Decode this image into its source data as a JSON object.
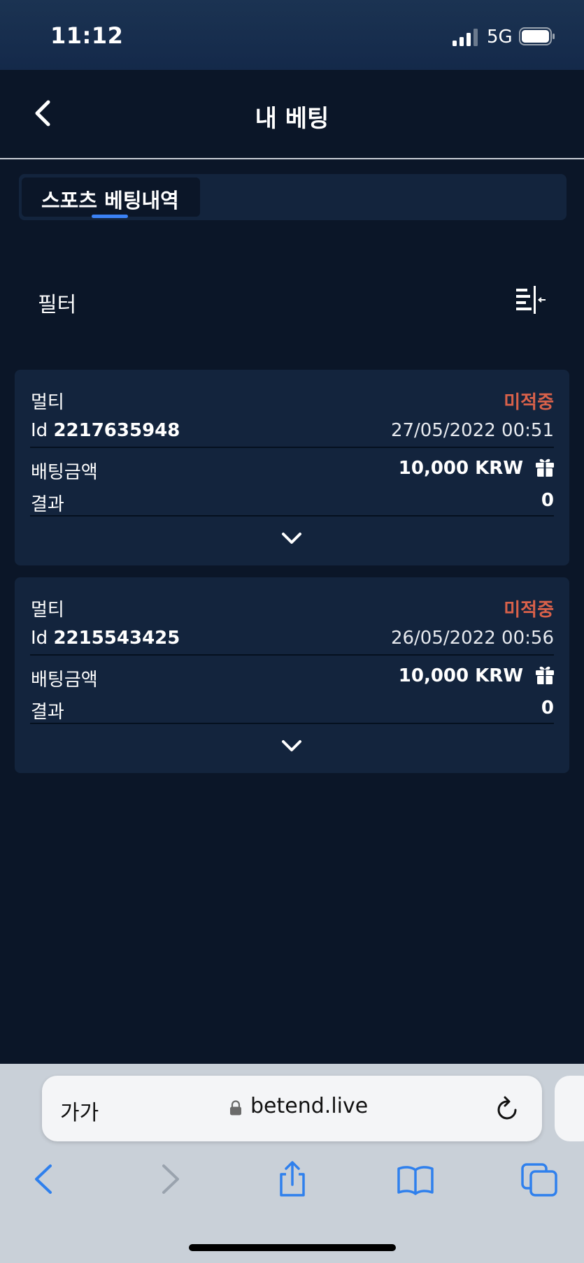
{
  "status_bar": {
    "time": "11:12",
    "network": "5G"
  },
  "header": {
    "title": "내 베팅"
  },
  "tabs": [
    {
      "label": "스포츠 베팅내역"
    }
  ],
  "filter": {
    "label": "필터"
  },
  "bets": [
    {
      "type": "멀티",
      "status": "미적중",
      "id_prefix": "Id",
      "id": "2217635948",
      "datetime": "27/05/2022 00:51",
      "amount_label": "배팅금액",
      "amount": "10,000 KRW",
      "result_label": "결과",
      "result": "0"
    },
    {
      "type": "멀티",
      "status": "미적중",
      "id_prefix": "Id",
      "id": "2215543425",
      "datetime": "26/05/2022 00:56",
      "amount_label": "배팅금액",
      "amount": "10,000 KRW",
      "result_label": "결과",
      "result": "0"
    }
  ],
  "browser": {
    "text_size_label": "가가",
    "url": "betend.live"
  },
  "colors": {
    "background": "#0b1628",
    "card": "#13243d",
    "status_lost": "#d9614a",
    "tab_accent": "#3b82f6",
    "safari_icon": "#2f80ed"
  }
}
